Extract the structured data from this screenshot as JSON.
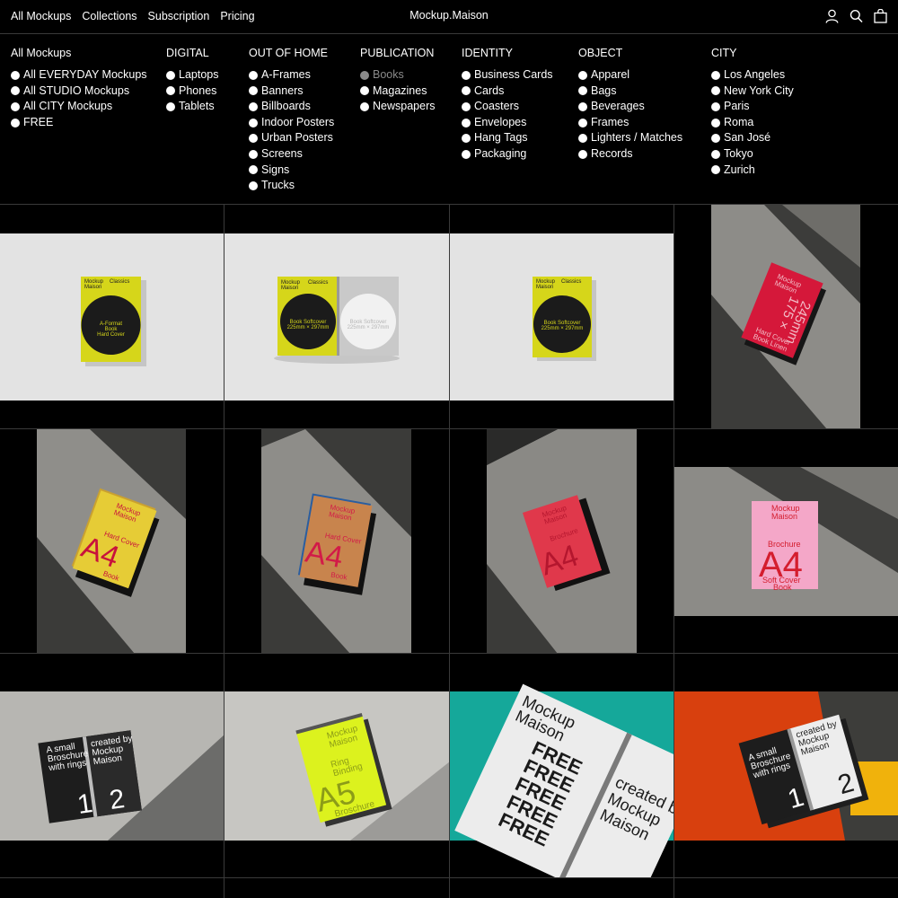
{
  "header": {
    "nav": [
      "All Mockups",
      "Collections",
      "Subscription",
      "Pricing"
    ],
    "brand": "Mockup.Maison",
    "icons": [
      "account-icon",
      "search-icon",
      "bag-icon"
    ]
  },
  "menu": {
    "columns": [
      {
        "title": "All Mockups",
        "items": [
          "All EVERYDAY Mockups",
          "All STUDIO Mockups",
          "All CITY Mockups",
          "FREE"
        ]
      },
      {
        "title": "DIGITAL",
        "items": [
          "Laptops",
          "Phones",
          "Tablets"
        ]
      },
      {
        "title": "OUT OF HOME",
        "items": [
          "A-Frames",
          "Banners",
          "Billboards",
          "Indoor Posters",
          "Urban Posters",
          "Screens",
          "Signs",
          "Trucks"
        ]
      },
      {
        "title": "PUBLICATION",
        "items": [
          "Books",
          "Magazines",
          "Newspapers"
        ],
        "active": "Books"
      },
      {
        "title": "IDENTITY",
        "items": [
          "Business Cards",
          "Cards",
          "Coasters",
          "Envelopes",
          "Hang Tags",
          "Packaging"
        ]
      },
      {
        "title": "OBJECT",
        "items": [
          "Apparel",
          "Bags",
          "Beverages",
          "Frames",
          "Lighters / Matches",
          "Records"
        ]
      },
      {
        "title": "CITY",
        "items": [
          "Los Angeles",
          "New York City",
          "Paris",
          "Roma",
          "San José",
          "Tokyo",
          "Zurich"
        ]
      }
    ]
  },
  "tiles": [
    {
      "a": "Mockup",
      "b": "Maison",
      "c": "Classics",
      "d": "A-Format",
      "e": "Book",
      "f": "Hard Cover"
    },
    {
      "a": "Mockup",
      "b": "Maison",
      "c": "Classics",
      "d": "Book Softcover",
      "e": "225mm × 297mm",
      "g": "Book Softcover",
      "h": "225mm × 297mm"
    },
    {
      "a": "Mockup",
      "b": "Maison",
      "c": "Classics",
      "d": "Book Softcover",
      "e": "225mm × 297mm"
    },
    {
      "a": "Mockup",
      "b": "Maison",
      "c": "175 ×",
      "d": "245mm",
      "e": "Hard Cover",
      "f": "Book Linen"
    },
    {
      "a": "Mockup",
      "b": "Maison",
      "c": "Hard Cover",
      "d": "A4",
      "e": "Book"
    },
    {
      "a": "Mockup",
      "b": "Maison",
      "c": "Hard Cover",
      "d": "A4",
      "e": "Book"
    },
    {
      "a": "Mockup",
      "b": "Maison",
      "c": "Brochure",
      "d": "A4"
    },
    {
      "a": "Mockup",
      "b": "Maison",
      "c": "Brochure",
      "d": "A4",
      "e": "Soft Cover",
      "f": "Book"
    },
    {
      "a": "A small",
      "b": "Broschure",
      "c": "with rings",
      "d": "created by",
      "e": "Mockup",
      "f": "Maison",
      "g": "1",
      "h": "2"
    },
    {
      "a": "Mockup",
      "b": "Maison",
      "c": "Ring",
      "d": "Binding",
      "e": "A5",
      "f": "Broschure"
    },
    {
      "a": "Mockup",
      "b": "Maison",
      "c": "FREE",
      "d": "created by",
      "e": "Mockup",
      "f": "Maison"
    },
    {
      "a": "A small",
      "b": "Broschure",
      "c": "with rings",
      "d": "created by",
      "e": "Mockup",
      "f": "Maison",
      "g": "1",
      "h": "2"
    }
  ],
  "colors": {
    "yellow": "#d9d91c",
    "red": "#e0263c",
    "pink": "#f4a7c8",
    "lime": "#dcf21e",
    "teal": "#15a89a",
    "orange": "#d8400e",
    "copper": "#c8844d"
  }
}
